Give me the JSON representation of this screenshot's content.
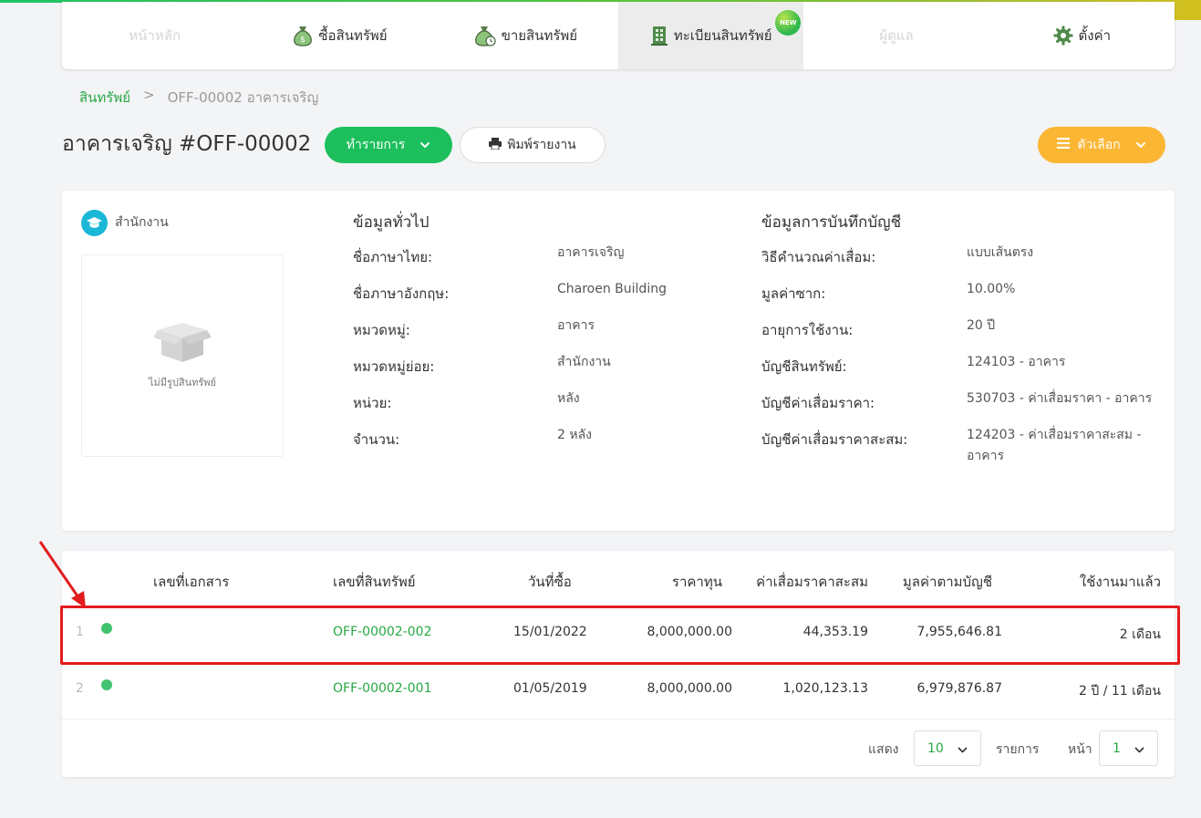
{
  "nav": {
    "items": [
      {
        "label": "หน้าหลัก",
        "icon": "home-icon"
      },
      {
        "label": "ซื้อสินทรัพย์",
        "icon": "money-bag-icon"
      },
      {
        "label": "ขายสินทรัพย์",
        "icon": "money-bag-clock-icon"
      },
      {
        "label": "ทะเบียนสินทรัพย์",
        "icon": "building-icon",
        "badge": "NEW"
      },
      {
        "label": "ผู้ดูแล",
        "icon": "user-icon"
      },
      {
        "label": "ตั้งค่า",
        "icon": "gear-icon"
      }
    ]
  },
  "breadcrumb": {
    "root": "สินทรัพย์",
    "separator": ">",
    "current": "OFF-00002 อาคารเจริญ"
  },
  "page": {
    "title": "อาคารเจริญ #OFF-00002",
    "action_button": "ทำรายการ",
    "print_button": "พิมพ์รายงาน",
    "options_button": "ตัวเลือก"
  },
  "info": {
    "category_label": "สำนักงาน",
    "no_image_text": "ไม่มีรูปสินทรัพย์",
    "general_title": "ข้อมูลทั่วไป",
    "general": [
      {
        "label": "ชื่อภาษาไทย:",
        "value": "อาคารเจริญ"
      },
      {
        "label": "ชื่อภาษาอังกฤษ:",
        "value": "Charoen Building"
      },
      {
        "label": "หมวดหมู่:",
        "value": "อาคาร"
      },
      {
        "label": "หมวดหมู่ย่อย:",
        "value": "สำนักงาน"
      },
      {
        "label": "หน่วย:",
        "value": "หลัง"
      },
      {
        "label": "จำนวน:",
        "value": "2 หลัง"
      }
    ],
    "accounting_title": "ข้อมูลการบันทึกบัญชี",
    "accounting": [
      {
        "label": "วิธีคำนวณค่าเสื่อม:",
        "value": "แบบเส้นตรง"
      },
      {
        "label": "มูลค่าซาก:",
        "value": "10.00%"
      },
      {
        "label": "อายุการใช้งาน:",
        "value": "20 ปี"
      },
      {
        "label": "บัญชีสินทรัพย์:",
        "value": "124103 - อาคาร"
      },
      {
        "label": "บัญชีค่าเสื่อมราคา:",
        "value": "530703 - ค่าเสื่อมราคา - อาคาร"
      },
      {
        "label": "บัญชีค่าเสื่อมราคาสะสม:",
        "value": "124203 - ค่าเสื่อมราคาสะสม -",
        "value2": "อาคาร"
      }
    ]
  },
  "table": {
    "headers": [
      "เลขที่เอกสาร",
      "เลขที่สินทรัพย์",
      "วันที่ซื้อ",
      "ราคาทุน",
      "ค่าเสื่อมราคาสะสม",
      "มูลค่าตามบัญชี",
      "ใช้งานมาแล้ว"
    ],
    "rows": [
      {
        "index": "1",
        "doc_no": "",
        "asset_no": "OFF-00002-002",
        "date": "15/01/2022",
        "cost": "8,000,000.00",
        "accum_dep": "44,353.19",
        "book_value": "7,955,646.81",
        "used": "2 เดือน",
        "status_color": "#41c46f"
      },
      {
        "index": "2",
        "doc_no": "",
        "asset_no": "OFF-00002-001",
        "date": "01/05/2019",
        "cost": "8,000,000.00",
        "accum_dep": "1,020,123.13",
        "book_value": "6,979,876.87",
        "used": "2 ปี / 11 เดือน",
        "status_color": "#41c46f"
      }
    ]
  },
  "pagination": {
    "show_label": "แสดง",
    "page_size": "10",
    "items_label": "รายการ",
    "page_label": "หน้า",
    "page": "1"
  },
  "colors": {
    "primary_green": "#1cbf5c",
    "link_green": "#27a844",
    "orange": "#fbb634",
    "annotation_red": "#e21c1c"
  }
}
